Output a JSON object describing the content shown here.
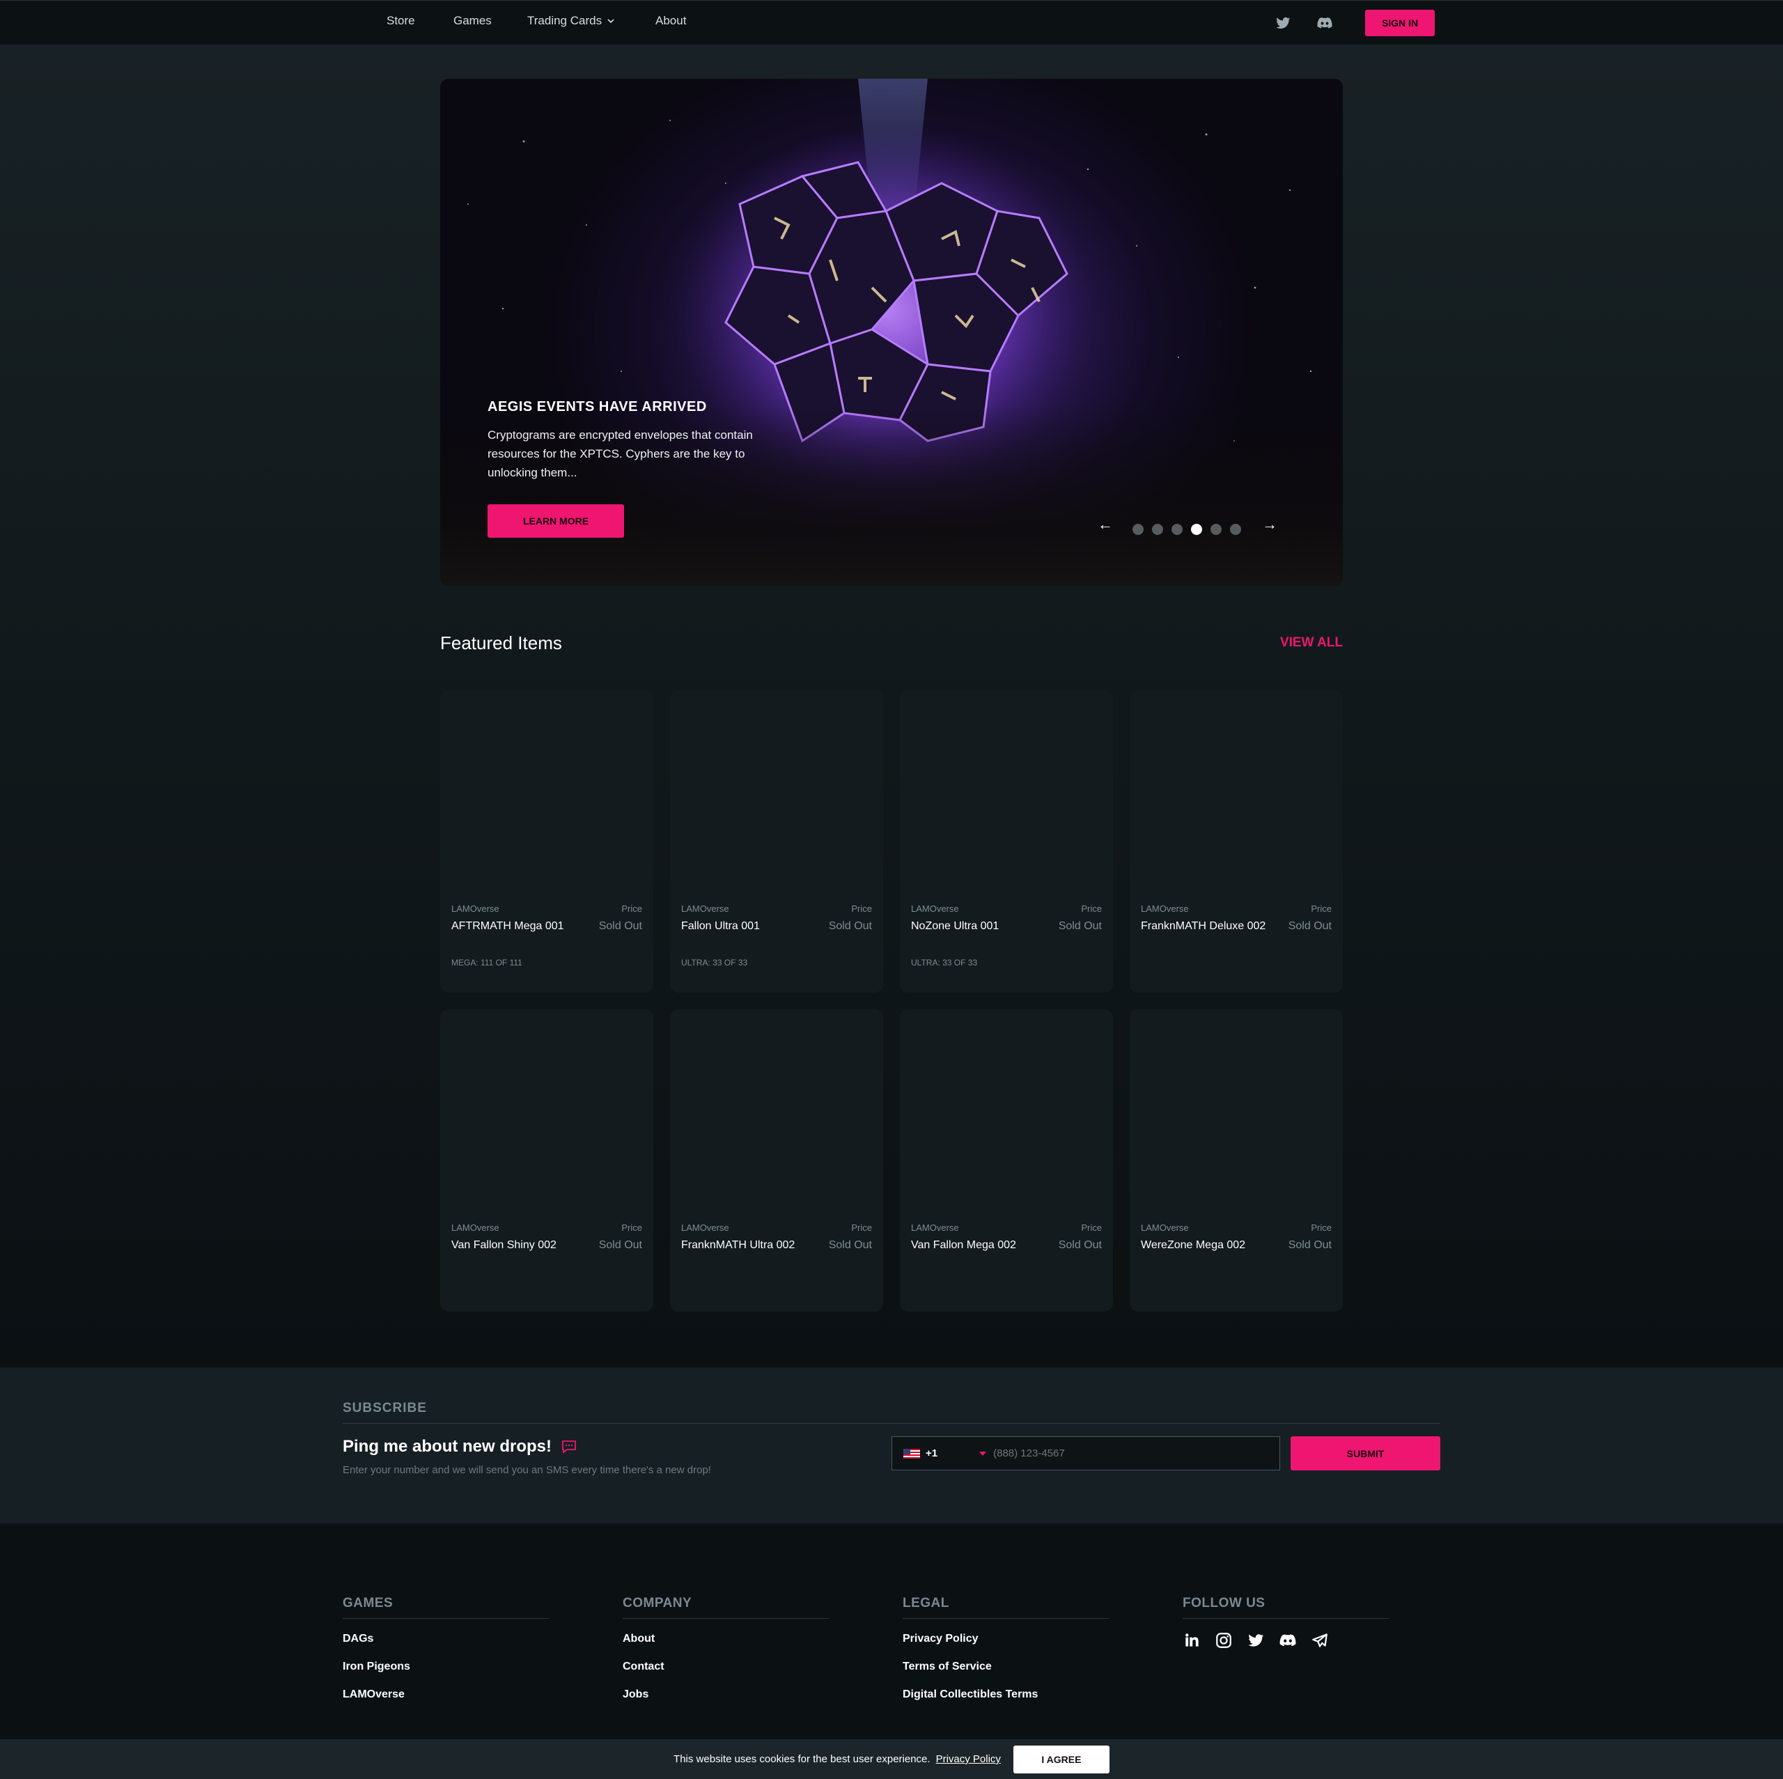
{
  "nav": {
    "links": [
      "Store",
      "Games",
      "Trading Cards",
      "About"
    ],
    "signin_label": "SIGN IN",
    "icons": [
      "twitter-icon",
      "discord-icon"
    ]
  },
  "hero": {
    "title": "AEGIS EVENTS HAVE ARRIVED",
    "description": "Cryptograms are encrypted envelopes that contain resources for the XPTCS. Cyphers are the key to unlocking them...",
    "cta_label": "LEARN MORE",
    "prev_arrow": "←",
    "next_arrow": "→",
    "slide_count": 6,
    "active_slide": 4
  },
  "featured": {
    "title": "Featured Items",
    "view_all_label": "VIEW ALL",
    "cards": [
      {
        "brand": "LAMOverse",
        "price_label": "Price",
        "name": "AFTRMATH Mega 001",
        "price": "Sold Out",
        "edition": "MEGA: 111 OF 111"
      },
      {
        "brand": "LAMOverse",
        "price_label": "Price",
        "name": "Fallon Ultra 001",
        "price": "Sold Out",
        "edition": "ULTRA: 33 OF 33"
      },
      {
        "brand": "LAMOverse",
        "price_label": "Price",
        "name": "NoZone Ultra 001",
        "price": "Sold Out",
        "edition": "ULTRA: 33 OF 33"
      },
      {
        "brand": "LAMOverse",
        "price_label": "Price",
        "name": "FranknMATH Deluxe 002",
        "price": "Sold Out",
        "edition": ""
      },
      {
        "brand": "LAMOverse",
        "price_label": "Price",
        "name": "Van Fallon Shiny 002",
        "price": "Sold Out",
        "edition": ""
      },
      {
        "brand": "LAMOverse",
        "price_label": "Price",
        "name": "FranknMATH Ultra 002",
        "price": "Sold Out",
        "edition": ""
      },
      {
        "brand": "LAMOverse",
        "price_label": "Price",
        "name": "Van Fallon Mega 002",
        "price": "Sold Out",
        "edition": ""
      },
      {
        "brand": "LAMOverse",
        "price_label": "Price",
        "name": "WereZone Mega 002",
        "price": "Sold Out",
        "edition": ""
      }
    ]
  },
  "subscribe": {
    "heading": "SUBSCRIBE",
    "title": "Ping me about new drops!",
    "description": "Enter your number and we will send you an SMS every time there's a new drop!",
    "dial_code": "+1",
    "phone_placeholder": "(888) 123-4567",
    "submit_label": "SUBMIT"
  },
  "footer": {
    "games": {
      "title": "GAMES",
      "links": [
        "DAGs",
        "Iron Pigeons",
        "LAMOverse"
      ]
    },
    "company": {
      "title": "COMPANY",
      "links": [
        "About",
        "Contact",
        "Jobs"
      ]
    },
    "legal": {
      "title": "LEGAL",
      "links": [
        "Privacy Policy",
        "Terms of Service",
        "Digital Collectibles Terms"
      ]
    },
    "follow": {
      "title": "FOLLOW US",
      "icons": [
        "linkedin-icon",
        "instagram-icon",
        "twitter-icon",
        "discord-icon",
        "telegram-icon"
      ]
    }
  },
  "cookie": {
    "text": "This website uses cookies for the best user experience.",
    "link_label": "Privacy Policy",
    "agree_label": "I AGREE"
  },
  "colors": {
    "accent": "#ee1671",
    "background": "#0b1113",
    "card": "#141b1e"
  }
}
